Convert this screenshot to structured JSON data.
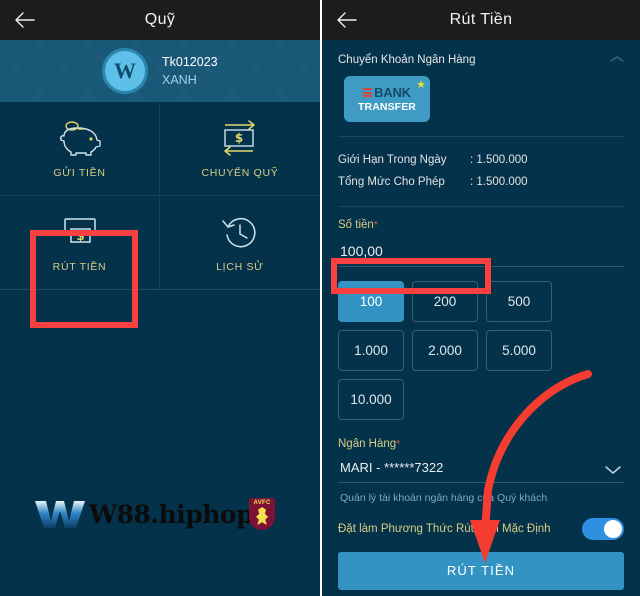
{
  "left": {
    "topbar": {
      "title": "Quỹ",
      "back_icon": "back-arrow-icon"
    },
    "account": {
      "avatar_letter": "W",
      "id": "Tk012023",
      "name": "XANH"
    },
    "menu": [
      {
        "label": "GỬI TIỀN",
        "icon": "piggy-bank-icon"
      },
      {
        "label": "CHUYỂN QUỸ",
        "icon": "transfer-funds-icon"
      },
      {
        "label": "RÚT TIỀN",
        "icon": "atm-withdraw-icon"
      },
      {
        "label": "LỊCH SỬ",
        "icon": "history-clock-icon"
      }
    ],
    "watermark": {
      "text": "W88.hiphop",
      "badge": "AVFC"
    }
  },
  "right": {
    "topbar": {
      "title": "Rút Tiền",
      "back_icon": "back-arrow-icon"
    },
    "method_section": {
      "title": "Chuyển Khoản Ngân Hàng",
      "collapse_icon": "chevron-collapse-icon",
      "card": {
        "line1": "BANK",
        "line2": "TRANSFER",
        "star_icon": "star-icon"
      }
    },
    "limits": [
      {
        "label": "Giới Hạn Trong Ngày",
        "value": ": 1.500.000"
      },
      {
        "label": "Tổng Mức Cho Phép",
        "value": ": 1.500.000"
      }
    ],
    "amount": {
      "label": "Số tiền",
      "required": "*",
      "value": "100,00"
    },
    "chips": [
      "100",
      "200",
      "500",
      "1.000",
      "2.000",
      "5.000",
      "10.000"
    ],
    "chip_active": "100",
    "bank": {
      "label": "Ngân Hàng",
      "required": "*",
      "value": "MARI - ******7322",
      "chevron_icon": "chevron-down-icon",
      "help": "Quản lý tài khoản ngân hàng của Quý khách"
    },
    "default_toggle": {
      "label": "Đặt làm Phương Thức Rút Tiền Mặc Định",
      "state": "on"
    },
    "submit": {
      "label": "RÚT TIỀN"
    }
  },
  "annotations": {
    "highlight_color": "#f94040",
    "arrow_color": "#f43c30"
  }
}
